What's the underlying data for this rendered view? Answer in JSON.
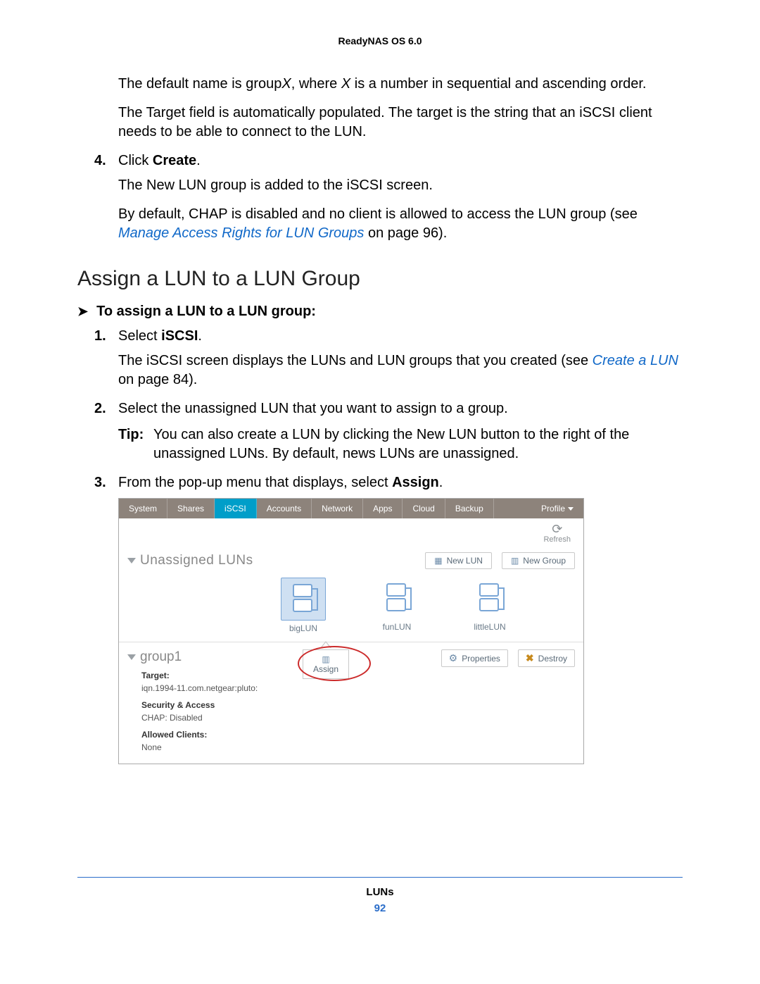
{
  "header": {
    "product": "ReadyNAS OS 6.0"
  },
  "intro": {
    "p1a": "The default name is group",
    "p1b": ", where ",
    "p1c": " is a number in sequential and ascending order.",
    "x": "X",
    "p2": "The Target field is automatically populated. The target is the string that an iSCSI client needs to be able to connect to the LUN."
  },
  "step4": {
    "num": "4.",
    "pre": "Click ",
    "bold": "Create",
    "post": ".",
    "after1": "The New LUN group is added to the iSCSI screen.",
    "after2a": "By default, CHAP is disabled and no client is allowed to access the LUN group (see ",
    "after2link": "Manage Access Rights for LUN Groups",
    "after2b": " on page 96)."
  },
  "heading": "Assign a LUN to a LUN Group",
  "task_intro": "To assign a LUN to a LUN group:",
  "steps": {
    "s1": {
      "num": "1.",
      "pre": "Select ",
      "bold": "iSCSI",
      "post": ".",
      "after_a": "The iSCSI screen displays the LUNs and LUN groups that you created (see ",
      "after_link": "Create a LUN",
      "after_b": " on page 84)."
    },
    "s2": {
      "num": "2.",
      "text": "Select the unassigned LUN that you want to assign to a group."
    },
    "tip": {
      "label": "Tip:",
      "text": "You can also create a LUN by clicking the New LUN button to the right of the unassigned LUNs. By default, news LUNs are unassigned."
    },
    "s3": {
      "num": "3.",
      "pre": "From the pop-up menu that displays, select ",
      "bold": "Assign",
      "post": "."
    }
  },
  "figure": {
    "tabs": {
      "system": "System",
      "shares": "Shares",
      "iscsi": "iSCSI",
      "accounts": "Accounts",
      "network": "Network",
      "apps": "Apps",
      "cloud": "Cloud",
      "backup": "Backup",
      "profile": "Profile"
    },
    "refresh": "Refresh",
    "unassigned": "Unassigned LUNs",
    "new_lun": "New LUN",
    "new_group": "New Group",
    "luns": {
      "big": "bigLUN",
      "fun": "funLUN",
      "little": "littleLUN"
    },
    "group": {
      "name": "group1",
      "target_lbl": "Target:",
      "target_val": "iqn.1994-11.com.netgear:pluto:",
      "sec_lbl": "Security & Access",
      "sec_val": "CHAP: Disabled",
      "clients_lbl": "Allowed Clients:",
      "clients_val": "None",
      "assign": "Assign",
      "properties": "Properties",
      "destroy": "Destroy"
    }
  },
  "footer": {
    "section": "LUNs",
    "page": "92"
  }
}
